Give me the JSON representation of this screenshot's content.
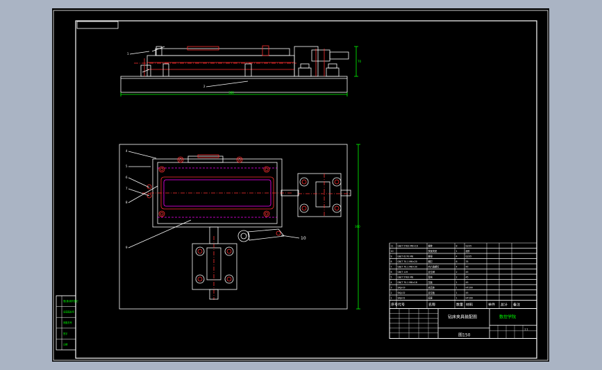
{
  "drawing": {
    "colors": {
      "background": "#000000",
      "frame": "#ffffff",
      "part_outline": "#ffffff",
      "part_detail": "#ff3030",
      "centerline": "#ff3030",
      "hidden": "#ff00ff",
      "dimension": "#00ff00",
      "leader": "#ffffff",
      "table_text": "#ffffff",
      "stamp_text": "#00ff00"
    },
    "dimensions": {
      "front_width": "380",
      "front_height": "70",
      "top_height": "360"
    },
    "leaders": {
      "front": [
        "1",
        "2",
        "3"
      ],
      "top": [
        "4",
        "5",
        "6",
        "7",
        "8",
        "9",
        "10"
      ]
    }
  },
  "bom": {
    "rows": [
      {
        "num": "11",
        "code": "GB/T 5783 M6×16",
        "name": "螺栓",
        "qty": "8",
        "material": "Q235"
      },
      {
        "num": "10",
        "code": "",
        "name": "快速夹钳",
        "qty": "1",
        "material": "组件"
      },
      {
        "num": "9",
        "code": "GB/T 6170 M8",
        "name": "螺母",
        "qty": "4",
        "material": "Q235"
      },
      {
        "num": "8",
        "code": "GB/T 70.1 M6×20",
        "name": "螺钉",
        "qty": "6",
        "material": "35"
      },
      {
        "num": "7",
        "code": "GB/T 70.1 M8×30",
        "name": "内六角螺钉",
        "qty": "4",
        "material": "45"
      },
      {
        "num": "6",
        "code": "GB/T 119",
        "name": "定位销",
        "qty": "2",
        "material": "45"
      },
      {
        "num": "5",
        "code": "GB/T 5783 M8",
        "name": "垫块",
        "qty": "2",
        "material": "45"
      },
      {
        "num": "4",
        "code": "GB/T 70.1 M6×16",
        "name": "压板",
        "qty": "1",
        "material": "45"
      },
      {
        "num": "3",
        "code": "SKJJ-03",
        "name": "夹具体",
        "qty": "1",
        "material": "HT200"
      },
      {
        "num": "2",
        "code": "SKJJ-02",
        "name": "定位板",
        "qty": "1",
        "material": "45"
      },
      {
        "num": "1",
        "code": "SKJJ-01",
        "name": "底座",
        "qty": "1",
        "material": "HT200"
      }
    ],
    "header": {
      "num": "序号",
      "code": "代号",
      "name": "名称",
      "qty": "数量",
      "material": "材料",
      "weight_single": "单件",
      "weight_total": "总计",
      "note": "备注"
    }
  },
  "title_block": {
    "drawing_title": "钻床夹具装配图",
    "company": "数控学院",
    "drawing_number": "图150",
    "scale": "1:1"
  },
  "left_stamp": {
    "items": [
      "借(通)用件登记",
      "旧底图总号",
      "底图总号",
      "签字",
      "日期"
    ]
  }
}
